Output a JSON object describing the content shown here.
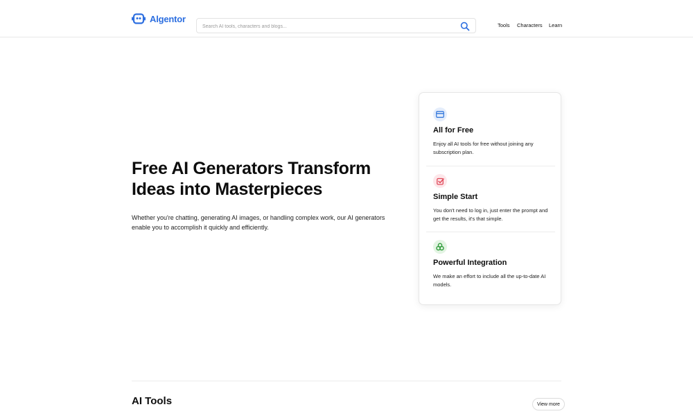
{
  "header": {
    "logo_text": "Algentor",
    "search": {
      "placeholder": "Search AI tools, characters and blogs...",
      "value": ""
    },
    "nav": [
      "Tools",
      "Characters",
      "Learn"
    ]
  },
  "hero": {
    "title_line1": "Free AI Generators Transform",
    "title_line2": "Ideas into Masterpieces",
    "description_line1": "Whether you're chatting, generating AI images, or handling complex work, our AI generators",
    "description_line2": "enable you to accomplish it quickly and efficiently."
  },
  "features": [
    {
      "icon": "credit-card-icon",
      "title": "All for Free",
      "text": "Enjoy all AI tools for free without joining any subscription plan.",
      "color": "#3b7ddd",
      "bg": "#e4edfb"
    },
    {
      "icon": "checkbox-icon",
      "title": "Simple Start",
      "text": "You don't need to log in, just enter the prompt and get the results, it's that simple.",
      "color": "#e04a5a",
      "bg": "#fde7ea"
    },
    {
      "icon": "integration-icon",
      "title": "Powerful Integration",
      "text": "We make an effort to include all the up-to-date AI models.",
      "color": "#2f9b3a",
      "bg": "#e3f4e3"
    }
  ],
  "tools_section": {
    "title": "AI Tools",
    "view_more": "View more"
  },
  "colors": {
    "brand": "#2d6fe0",
    "text": "#0d0d0d",
    "border": "#e6e6e6"
  }
}
